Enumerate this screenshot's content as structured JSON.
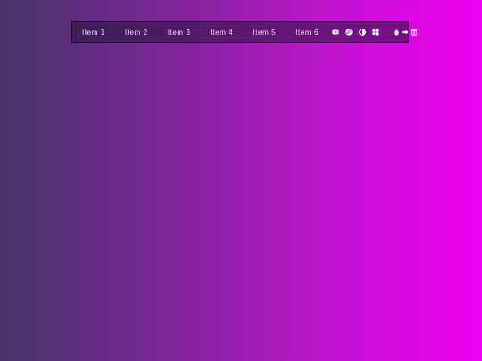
{
  "navbar": {
    "items": [
      {
        "label": "Item 1"
      },
      {
        "label": "Item 2"
      },
      {
        "label": "Item 3"
      },
      {
        "label": "Item 4"
      },
      {
        "label": "Item 5"
      },
      {
        "label": "Item 6"
      }
    ],
    "icons": [
      "youtube-icon",
      "steam-icon",
      "pie-icon",
      "windows-icon",
      "apple-icon",
      "arrow-icon",
      "trash-icon"
    ]
  },
  "colors": {
    "gradient_start": "#4a3568",
    "gradient_end": "#f000f2",
    "navbar_background": "#3a1a50",
    "text": "#e6dcea"
  }
}
